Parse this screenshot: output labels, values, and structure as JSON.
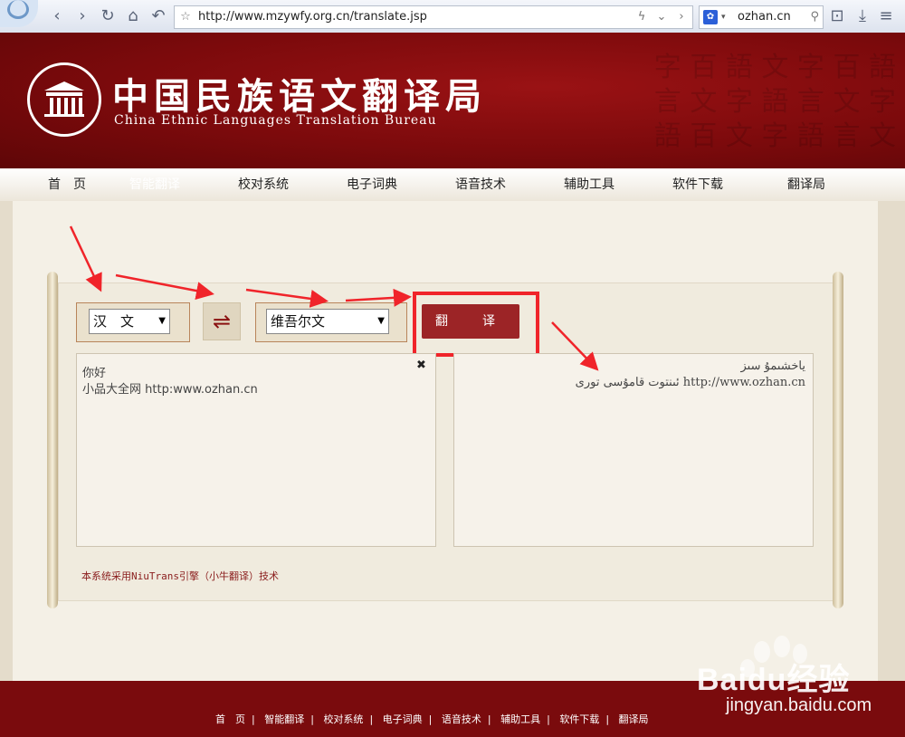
{
  "browser": {
    "url": "http://www.mzywfy.org.cn/translate.jsp",
    "search_text": "ozhan.cn"
  },
  "header": {
    "title_cn": "中国民族语文翻译局",
    "title_en": "China Ethnic Languages Translation Bureau"
  },
  "nav": {
    "items": [
      {
        "label": "首　页"
      },
      {
        "label": "智能翻译"
      },
      {
        "label": "校对系统"
      },
      {
        "label": "电子词典"
      },
      {
        "label": "语音技术"
      },
      {
        "label": "辅助工具"
      },
      {
        "label": "软件下载"
      },
      {
        "label": "翻译局"
      }
    ],
    "active_index": 1
  },
  "translator": {
    "source_language": "汉　文",
    "target_language": "维吾尔文",
    "translate_button": "翻　译",
    "swap_symbol": "⇌",
    "source_text_lines": [
      "你好",
      "小品大全网 http:www.ozhan.cn"
    ],
    "target_text_lines": [
      "ياخشىمۇ سىز",
      "http://www.ozhan.cn ئىنتوت قامۇسى تورى"
    ],
    "tech_note": "本系统采用NiuTrans引擎（小牛翻译）技术"
  },
  "footer": {
    "links": [
      "首　页",
      "智能翻译",
      "校对系统",
      "电子词典",
      "语音技术",
      "辅助工具",
      "软件下载",
      "翻译局"
    ],
    "separator": "|"
  },
  "watermark": {
    "brand": "Baidu经验",
    "url": "jingyan.baidu.com"
  },
  "colors": {
    "brand_red": "#7a0b0d",
    "button_red": "#9c2426",
    "highlight_red": "#f0242a"
  }
}
